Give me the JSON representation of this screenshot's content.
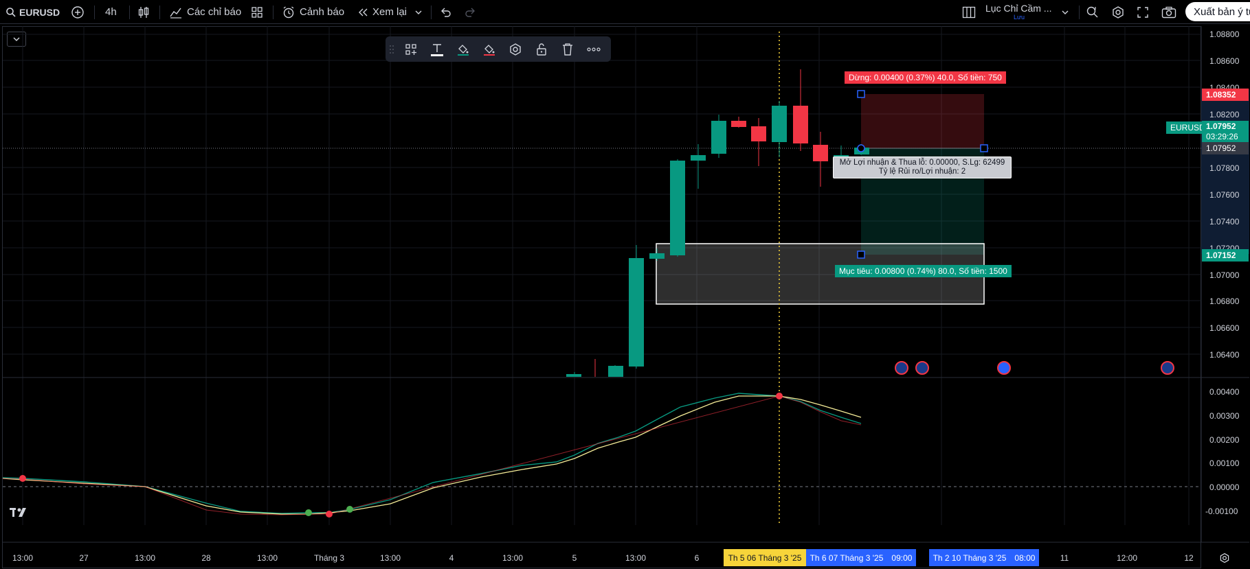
{
  "topbar": {
    "symbol": "EURUSD",
    "interval": "4h",
    "indicators_label": "Các chỉ báo",
    "alerts_label": "Cảnh báo",
    "replay_label": "Xem lại",
    "layout_name": "Lục Chỉ Cầm ...",
    "layout_sub": "Lưu",
    "publish_label": "Xuất bản ý tư"
  },
  "price_axis": [
    "1.08800",
    "1.08600",
    "1.08400",
    "1.08200",
    "1.07800",
    "1.07600",
    "1.07400",
    "1.07200",
    "1.07000",
    "1.06800",
    "1.06600",
    "1.06400"
  ],
  "price_tags": {
    "stop": "1.08352",
    "symbol_name": "EURUSD",
    "current": "1.07952",
    "countdown": "03:29:26",
    "crosshair": "1.07952",
    "target": "1.07152"
  },
  "osc_axis": [
    "0.00400",
    "0.00300",
    "0.00200",
    "0.00100",
    "0.00000",
    "-0.00100"
  ],
  "position": {
    "stop_label": "Dừng: 0.00400 (0.37%) 40.0, Số tiền: 750",
    "open_label_1": "Mở Lợi nhuận & Thua lỗ: 0.00000, S.Lg: 62499",
    "open_label_2": "Tỷ lệ Rủi ro/Lợi nhuận: 2",
    "target_label": "Mục tiêu: 0.00800 (0.74%) 80.0, Số tiền: 1500"
  },
  "time_axis": [
    "13:00",
    "27",
    "13:00",
    "28",
    "13:00",
    "Tháng 3",
    "13:00",
    "4",
    "13:00",
    "5",
    "13:00",
    "6",
    "11",
    "12:00",
    "12"
  ],
  "time_highlights": {
    "crosshair": "Th 5 06 Tháng 3 '25",
    "start_date": "Th 6 07 Tháng 3 '25",
    "start_time": "09:00",
    "end_date": "Th 2 10 Tháng 3 '25",
    "end_time": "08:00"
  },
  "colors": {
    "up": "#089981",
    "down": "#f23645",
    "crosshair_time": "#f7d43a",
    "range_time": "#2962ff"
  },
  "icons": [
    "search-icon",
    "plus-circle-icon",
    "candles-icon",
    "indicators-icon",
    "templates-icon",
    "alarm-icon",
    "replay-icon",
    "undo-icon",
    "redo-icon",
    "layout-icon",
    "zoom-icon",
    "settings-icon",
    "fullscreen-icon",
    "camera-icon"
  ]
}
